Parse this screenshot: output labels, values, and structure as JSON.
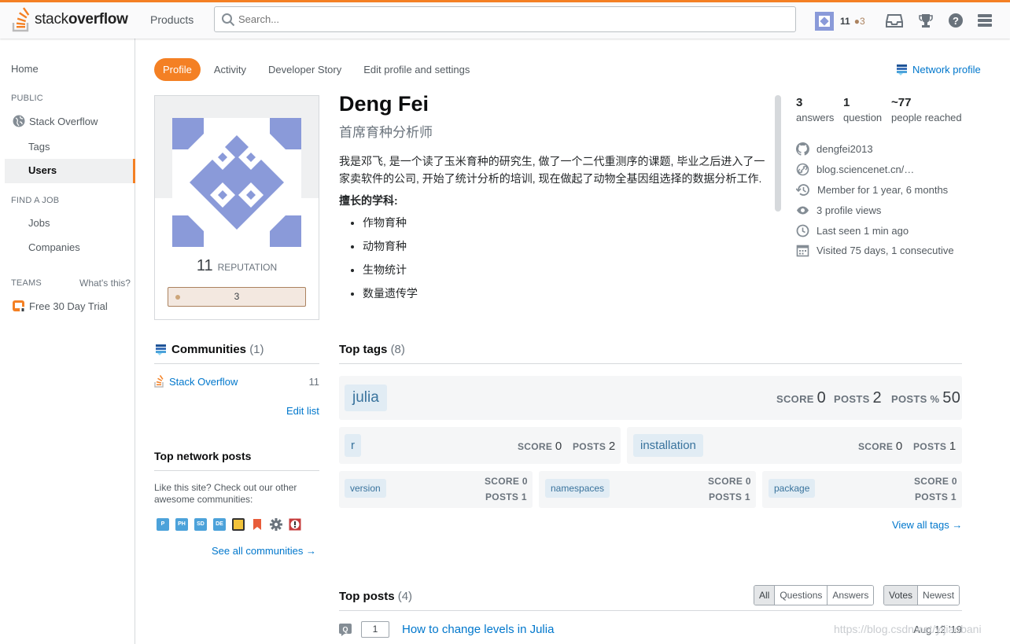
{
  "topbar": {
    "logo_light": "stack",
    "logo_bold": "overflow",
    "products": "Products",
    "search_placeholder": "Search...",
    "reputation": "11",
    "bronze_badges": "3"
  },
  "nav": {
    "home": "Home",
    "public_header": "PUBLIC",
    "stack_overflow": "Stack Overflow",
    "tags": "Tags",
    "users": "Users",
    "find_job_header": "FIND A JOB",
    "jobs": "Jobs",
    "companies": "Companies",
    "teams_header": "TEAMS",
    "whats_this": "What's this?",
    "free_trial": "Free 30 Day Trial"
  },
  "tabs": [
    {
      "label": "Profile",
      "active": true
    },
    {
      "label": "Activity"
    },
    {
      "label": "Developer Story"
    },
    {
      "label": "Edit profile and settings"
    }
  ],
  "network_profile": "Network profile",
  "profile": {
    "name": "Deng Fei",
    "title": "首席育种分析师",
    "reputation_value": "11",
    "reputation_label": "REPUTATION",
    "badge_count": "3",
    "bio_paragraph": "我是邓飞, 是一个读了玉米育种的研究生, 做了一个二代重测序的课题, 毕业之后进入了一家卖软件的公司, 开始了统计分析的培训, 现在做起了动物全基因组选择的数据分析工作.",
    "bio_heading": "擅长的学科:",
    "bio_items": [
      "作物育种",
      "动物育种",
      "生物统计",
      "数量遗传学"
    ]
  },
  "stats": {
    "answers_value": "3",
    "answers_label": "answers",
    "questions_value": "1",
    "questions_label": "question",
    "reached_value": "~77",
    "reached_label": "people reached"
  },
  "info": {
    "github": "dengfei2013",
    "website": "blog.sciencenet.cn/…",
    "member_for": "Member for 1 year, 6 months",
    "profile_views": "3 profile views",
    "last_seen": "Last seen 1 min ago",
    "visited": "Visited 75 days, 1 consecutive"
  },
  "communities": {
    "title": "Communities",
    "count": "(1)",
    "items": [
      {
        "name": "Stack Overflow",
        "rep": "11"
      }
    ],
    "edit_list": "Edit list"
  },
  "network_posts": {
    "title": "Top network posts",
    "like_text": "Like this site? Check out our other awesome communities:",
    "icons": [
      "P",
      "PH",
      "SD",
      "DE",
      "",
      "",
      "",
      ""
    ],
    "see_all": "See all communities →"
  },
  "top_tags": {
    "title": "Top tags",
    "count": "(8)",
    "score_label": "SCORE",
    "posts_label": "POSTS",
    "posts_pct_label": "POSTS %",
    "items": [
      {
        "name": "julia",
        "score": "0",
        "posts": "2",
        "posts_pct": "50"
      },
      {
        "name": "r",
        "score": "0",
        "posts": "2"
      },
      {
        "name": "installation",
        "score": "0",
        "posts": "1"
      },
      {
        "name": "version",
        "score": "0",
        "posts": "1"
      },
      {
        "name": "namespaces",
        "score": "0",
        "posts": "1"
      },
      {
        "name": "package",
        "score": "0",
        "posts": "1"
      }
    ],
    "view_all": "View all tags →"
  },
  "top_posts": {
    "title": "Top posts",
    "count": "(4)",
    "filters": [
      "All",
      "Questions",
      "Answers"
    ],
    "sorts": [
      "Votes",
      "Newest"
    ],
    "items": [
      {
        "votes": "1",
        "title": "How to change levels in Julia",
        "date": "Aug 12 '19"
      }
    ]
  },
  "watermark": "https://blog.csdn.net/yijiaobani",
  "colors": {
    "accent": "#f48024",
    "link": "#0077cc",
    "avatar": "#8a9ad9",
    "tag_bg": "#e1ecf4",
    "tag_text": "#39739d"
  }
}
